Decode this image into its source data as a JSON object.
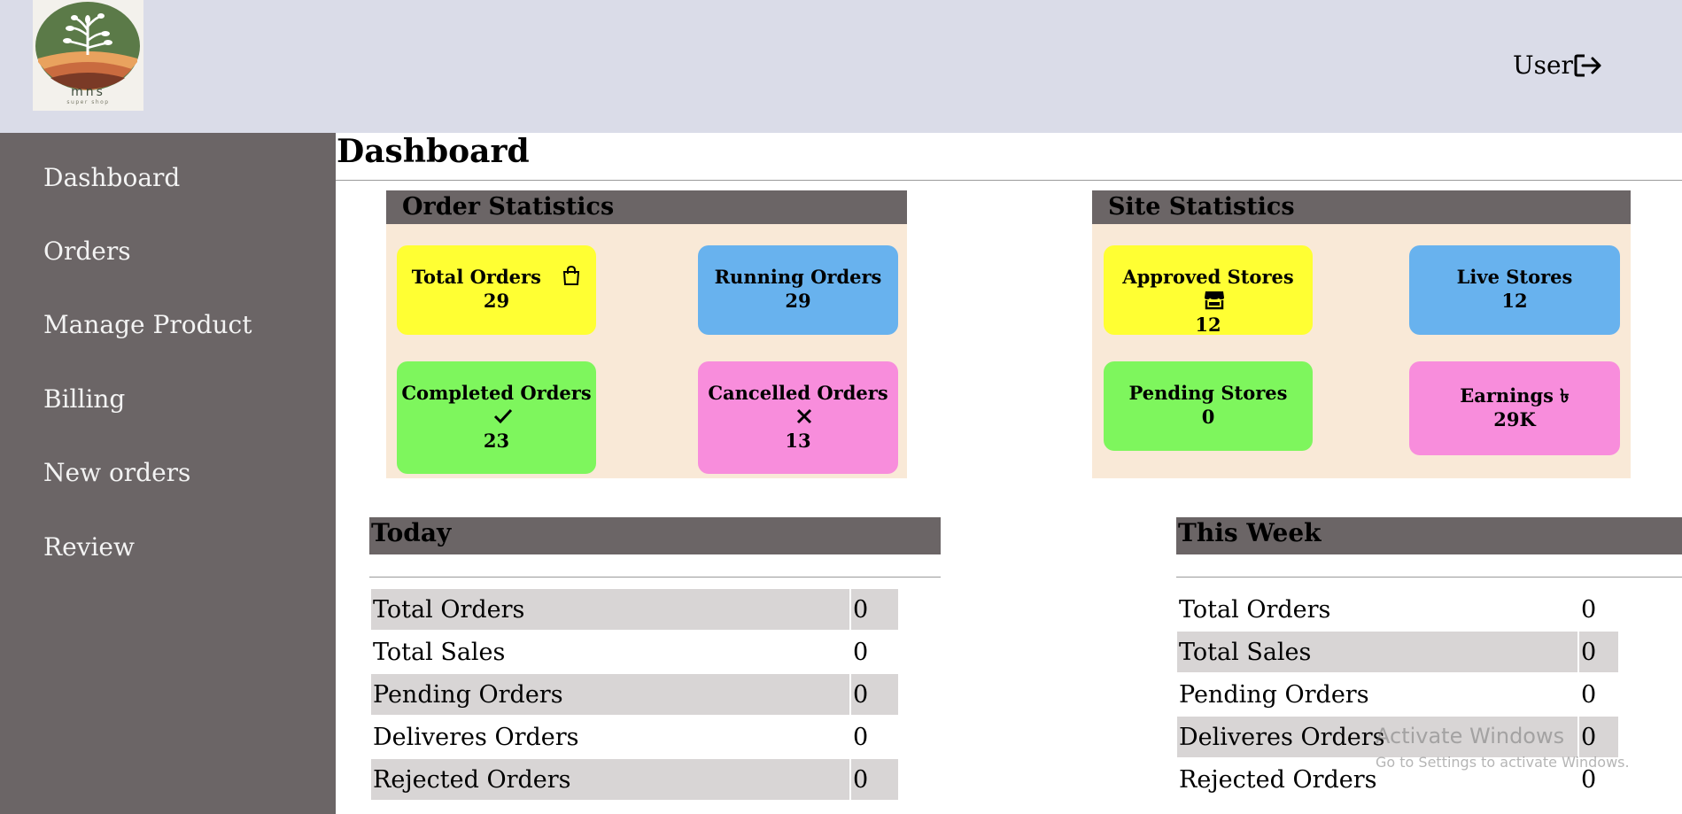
{
  "header": {
    "logo_text": "mns",
    "logo_subtext": "super shop",
    "user_label": "User"
  },
  "sidebar": {
    "items": [
      {
        "label": "Dashboard"
      },
      {
        "label": "Orders"
      },
      {
        "label": "Manage Product"
      },
      {
        "label": "Billing"
      },
      {
        "label": "New orders"
      },
      {
        "label": "Review"
      }
    ]
  },
  "main": {
    "title": "Dashboard",
    "order_statistics": {
      "heading": "Order Statistics",
      "cards": [
        {
          "label": "Total Orders",
          "value": "29",
          "icon": "shopping-bag-icon",
          "color": "#ffff33"
        },
        {
          "label": "Running Orders",
          "value": "29",
          "color": "#68b2ee"
        },
        {
          "label": "Completed Orders",
          "value": "23",
          "icon": "check-icon",
          "color": "#7ef65d"
        },
        {
          "label": "Cancelled Orders",
          "value": "13",
          "icon": "close-icon",
          "color": "#f88ddc"
        }
      ]
    },
    "site_statistics": {
      "heading": "Site Statistics",
      "cards": [
        {
          "label": "Approved Stores",
          "value": "12",
          "icon": "store-icon",
          "color": "#ffff33"
        },
        {
          "label": "Live Stores",
          "value": "12",
          "color": "#68b2ee"
        },
        {
          "label": "Pending Stores",
          "value": "0",
          "color": "#7ef65d"
        },
        {
          "label": "Earnings",
          "symbol": "৳",
          "value": "29K",
          "color": "#f88ddc"
        }
      ]
    },
    "today": {
      "heading": "Today",
      "rows": [
        {
          "label": "Total Orders",
          "value": "0"
        },
        {
          "label": "Total Sales",
          "value": "0"
        },
        {
          "label": "Pending Orders",
          "value": "0"
        },
        {
          "label": "Deliveres Orders",
          "value": "0"
        },
        {
          "label": "Rejected Orders",
          "value": "0"
        }
      ]
    },
    "this_week": {
      "heading": "This Week",
      "rows": [
        {
          "label": "Total Orders",
          "value": "0"
        },
        {
          "label": "Total Sales",
          "value": "0"
        },
        {
          "label": "Pending Orders",
          "value": "0"
        },
        {
          "label": "Deliveres Orders",
          "value": "0"
        },
        {
          "label": "Rejected Orders",
          "value": "0"
        }
      ]
    }
  },
  "watermark": {
    "line1": "Activate Windows",
    "line2": "Go to Settings to activate Windows."
  }
}
